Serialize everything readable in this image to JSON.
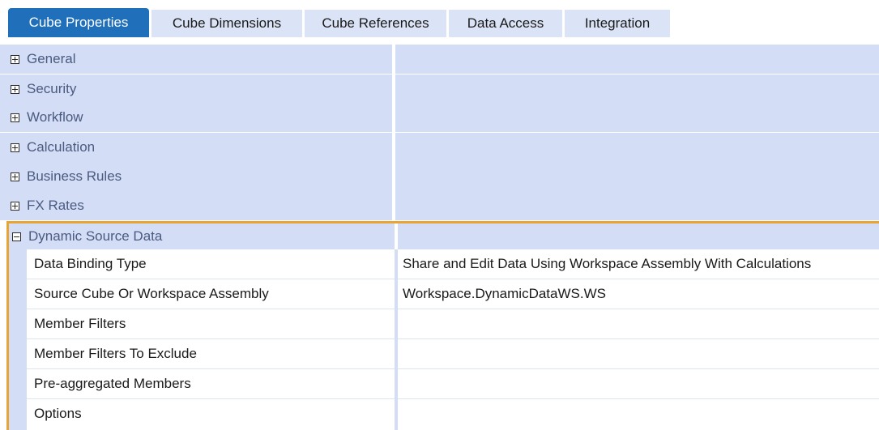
{
  "tabs": [
    {
      "label": "Cube Properties",
      "active": true
    },
    {
      "label": "Cube Dimensions",
      "active": false
    },
    {
      "label": "Cube References",
      "active": false
    },
    {
      "label": "Data Access",
      "active": false
    },
    {
      "label": "Integration",
      "active": false
    }
  ],
  "groups": [
    {
      "label": "General",
      "expanded": false
    },
    {
      "label": "Security",
      "expanded": false
    },
    {
      "label": "Workflow",
      "expanded": false
    },
    {
      "label": "Calculation",
      "expanded": false
    },
    {
      "label": "Business Rules",
      "expanded": false
    },
    {
      "label": "FX Rates",
      "expanded": false
    }
  ],
  "dynamic_section": {
    "label": "Dynamic Source Data",
    "expanded": true,
    "highlight_color": "#e8a534",
    "properties": [
      {
        "name": "Data Binding Type",
        "value": "Share and Edit Data Using Workspace Assembly With Calculations"
      },
      {
        "name": "Source Cube Or Workspace Assembly",
        "value": "Workspace.DynamicDataWS.WS"
      },
      {
        "name": "Member Filters",
        "value": ""
      },
      {
        "name": "Member Filters To Exclude",
        "value": ""
      },
      {
        "name": "Pre-aggregated Members",
        "value": ""
      },
      {
        "name": "Options",
        "value": ""
      }
    ]
  },
  "colors": {
    "active_tab": "#1f6fba",
    "inactive_tab": "#dbe4f7",
    "group_background": "#d4ddf6"
  }
}
